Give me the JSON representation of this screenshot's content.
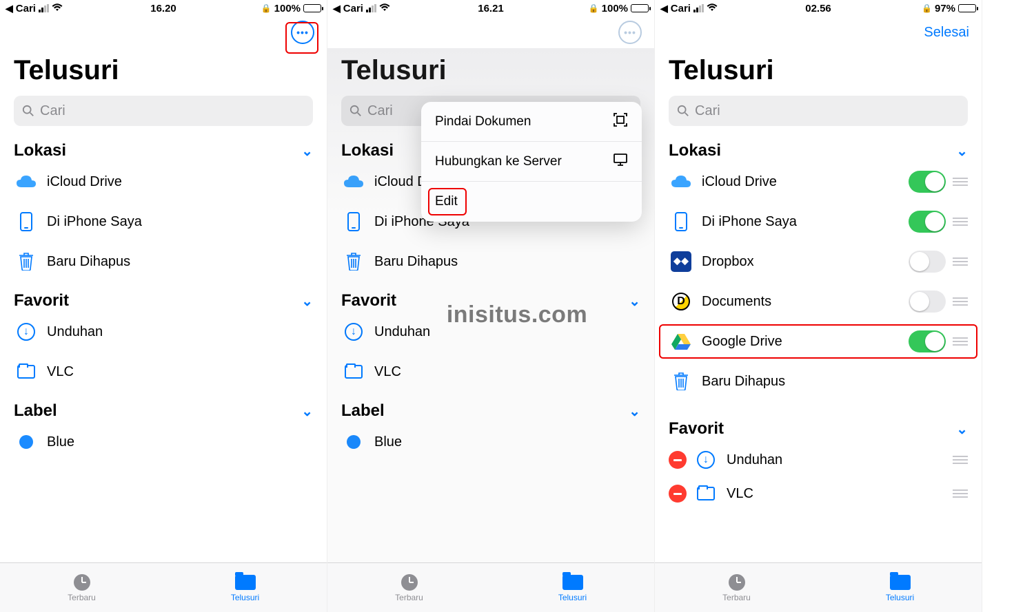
{
  "watermark": "inisitus.com",
  "panels": [
    {
      "status": {
        "back_app": "Cari",
        "time": "16.20",
        "battery": "100%"
      },
      "title": "Telusuri",
      "search_placeholder": "Cari",
      "done_label": null,
      "more_style": "normal",
      "sections": {
        "lokasi": {
          "label": "Lokasi",
          "items": [
            {
              "icon": "cloud",
              "label": "iCloud Drive"
            },
            {
              "icon": "phone",
              "label": "Di iPhone Saya"
            },
            {
              "icon": "trash",
              "label": "Baru Dihapus"
            }
          ]
        },
        "favorit": {
          "label": "Favorit",
          "items": [
            {
              "icon": "download",
              "label": "Unduhan"
            },
            {
              "icon": "folder",
              "label": "VLC"
            }
          ]
        },
        "label": {
          "label": "Label",
          "items": [
            {
              "icon": "bluedot",
              "label": "Blue"
            }
          ]
        }
      }
    },
    {
      "status": {
        "back_app": "Cari",
        "time": "16.21",
        "battery": "100%"
      },
      "title": "Telusuri",
      "search_placeholder": "Cari",
      "done_label": null,
      "more_style": "dim",
      "popup": [
        {
          "label": "Pindai Dokumen",
          "icon": "scan"
        },
        {
          "label": "Hubungkan ke Server",
          "icon": "server"
        },
        {
          "label": "Edit",
          "icon": null
        }
      ],
      "sections": {
        "lokasi": {
          "label": "Lokasi",
          "items": [
            {
              "icon": "cloud",
              "label": "iCloud Drive"
            },
            {
              "icon": "phone",
              "label": "Di iPhone Saya"
            },
            {
              "icon": "trash",
              "label": "Baru Dihapus"
            }
          ]
        },
        "favorit": {
          "label": "Favorit",
          "items": [
            {
              "icon": "download",
              "label": "Unduhan"
            },
            {
              "icon": "folder",
              "label": "VLC"
            }
          ]
        },
        "label": {
          "label": "Label",
          "items": [
            {
              "icon": "bluedot",
              "label": "Blue"
            }
          ]
        }
      }
    },
    {
      "status": {
        "back_app": "Cari",
        "time": "02.56",
        "battery": "97%"
      },
      "title": "Telusuri",
      "search_placeholder": "Cari",
      "done_label": "Selesai",
      "sections": {
        "lokasi": {
          "label": "Lokasi",
          "items": [
            {
              "icon": "cloud",
              "label": "iCloud Drive",
              "toggle": true
            },
            {
              "icon": "phone",
              "label": "Di iPhone Saya",
              "toggle": true
            },
            {
              "icon": "dropbox",
              "label": "Dropbox",
              "toggle": false
            },
            {
              "icon": "documents",
              "label": "Documents",
              "toggle": false
            },
            {
              "icon": "gdrive",
              "label": "Google Drive",
              "toggle": true,
              "highlight": true
            },
            {
              "icon": "trash",
              "label": "Baru Dihapus"
            }
          ]
        },
        "favorit": {
          "label": "Favorit",
          "items": [
            {
              "icon": "download",
              "label": "Unduhan",
              "removable": true
            },
            {
              "icon": "folder",
              "label": "VLC",
              "removable": true
            }
          ]
        }
      }
    }
  ],
  "tabs": {
    "recent": "Terbaru",
    "browse": "Telusuri"
  }
}
